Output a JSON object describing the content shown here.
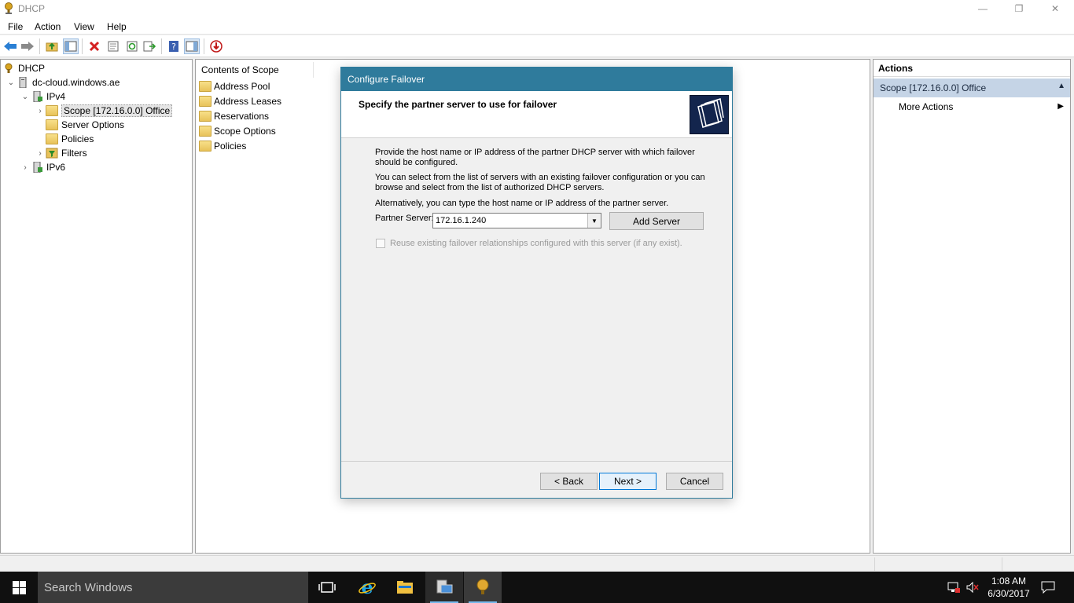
{
  "window": {
    "title": "DHCP",
    "controls": {
      "minimize": "—",
      "restore": "❐",
      "close": "✕"
    }
  },
  "menu": [
    "File",
    "Action",
    "View",
    "Help"
  ],
  "toolbar": {
    "icons": [
      "back-arrow-icon",
      "forward-arrow-icon",
      "up-folder-icon",
      "show-hide-tree-icon",
      "delete-icon",
      "properties-icon",
      "refresh-icon",
      "export-list-icon",
      "help-icon",
      "show-hide-action-pane-icon",
      "deactivate-icon"
    ]
  },
  "tree": {
    "items": [
      {
        "label": "DHCP",
        "icon": "dhcp-icon"
      },
      {
        "label": "dc-cloud.windows.ae",
        "expander": "⌄",
        "icon": "server-icon"
      },
      {
        "label": "IPv4",
        "expander": "⌄",
        "icon": "ipv4-icon"
      },
      {
        "label": "Scope [172.16.0.0] Office",
        "expander": "›",
        "icon": "folder-icon"
      },
      {
        "label": "Server Options",
        "icon": "server-options-icon"
      },
      {
        "label": "Policies",
        "icon": "policies-icon"
      },
      {
        "label": "Filters",
        "expander": "›",
        "icon": "filter-icon"
      },
      {
        "label": "IPv6",
        "expander": "›",
        "icon": "ipv6-icon"
      }
    ]
  },
  "contents": {
    "header": "Contents of Scope",
    "items": [
      "Address Pool",
      "Address Leases",
      "Reservations",
      "Scope Options",
      "Policies"
    ]
  },
  "actions": {
    "header": "Actions",
    "scope": "Scope [172.16.0.0] Office",
    "more": "More Actions"
  },
  "dialog": {
    "title": "Configure Failover",
    "heading": "Specify the partner server to use for failover",
    "para1": "Provide the host name or IP address of the partner DHCP server with which failover should be configured.",
    "para2": "You can select from the list of servers with an existing failover configuration or you can browse and select from the list of authorized DHCP servers.",
    "para3": "Alternatively, you can type the host name or IP address of the partner server.",
    "partner_label": "Partner Server:",
    "partner_value": "172.16.1.240",
    "add_server": "Add Server",
    "reuse_label": "Reuse existing failover relationships configured with this server (if any exist).",
    "back": "< Back",
    "next": "Next >",
    "cancel": "Cancel"
  },
  "taskbar": {
    "search_placeholder": "Search Windows",
    "time": "1:08 AM",
    "date": "6/30/2017"
  },
  "colors": {
    "dialog_title": "#2f7b9c",
    "selection": "#c5d4e6",
    "taskbar": "#101010"
  }
}
